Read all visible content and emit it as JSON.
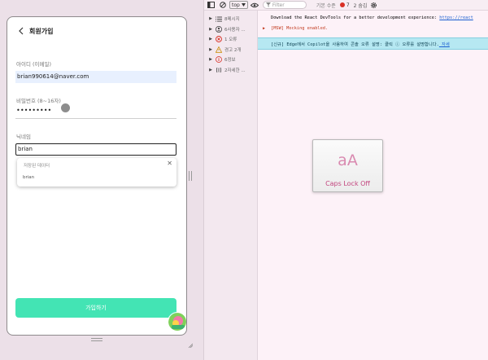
{
  "app": {
    "header_title": "회원가입",
    "fields": {
      "id_label": "아이디 (이메일)",
      "id_value": "brian990614@naver.com",
      "password_label": "비밀번호 (8~16자)",
      "password_value": "•••••••••",
      "nickname_label": "닉네임",
      "nickname_value": "brian"
    },
    "autofill": {
      "header": "저장된 데이터",
      "close_label": "✕",
      "items": [
        "brian"
      ]
    },
    "submit_label": "가입하기"
  },
  "devtools": {
    "toolbar": {
      "context": "top",
      "filter_placeholder": "Filter",
      "levels_label": "기본 수준",
      "issues_count": "7",
      "hidden_count": "2 숨김"
    },
    "sidebar": [
      {
        "label": "8메시지",
        "icon": "list-icon"
      },
      {
        "label": "6사용자 ...",
        "icon": "user-icon"
      },
      {
        "label": "1 오류",
        "icon": "error-icon"
      },
      {
        "label": "경고 2개",
        "icon": "warning-icon"
      },
      {
        "label": "6정보",
        "icon": "info-icon"
      },
      {
        "label": "2자세한 ...",
        "icon": "verbose-icon"
      }
    ],
    "messages": {
      "m1_text": "Download the React DevTools for a better development experience: ",
      "m1_link": "https://react",
      "m2_text": "[MSW] Mocking enabled.",
      "m3_text": "[신규] Edge에서 Copilot을 사용하여 콘솔 오류 설명: 클릭 ⓘ 오류를 설명합니다.",
      "m3_link": " 자세"
    }
  },
  "caps_lock": {
    "glyph": "aA",
    "label": "Caps Lock Off"
  },
  "colors": {
    "accent": "#43e4b4",
    "autofill_bg": "#e8f0fe",
    "caps_text": "#c2457e",
    "info_bg": "#b6e8f2",
    "error_red": "#d93025"
  }
}
